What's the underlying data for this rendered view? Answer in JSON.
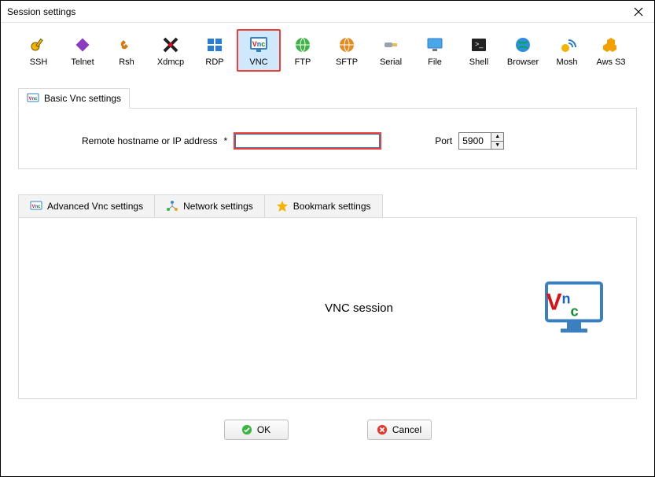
{
  "window": {
    "title": "Session settings"
  },
  "toolbar": {
    "items": [
      {
        "label": "SSH"
      },
      {
        "label": "Telnet"
      },
      {
        "label": "Rsh"
      },
      {
        "label": "Xdmcp"
      },
      {
        "label": "RDP"
      },
      {
        "label": "VNC"
      },
      {
        "label": "FTP"
      },
      {
        "label": "SFTP"
      },
      {
        "label": "Serial"
      },
      {
        "label": "File"
      },
      {
        "label": "Shell"
      },
      {
        "label": "Browser"
      },
      {
        "label": "Mosh"
      },
      {
        "label": "Aws S3"
      }
    ],
    "selected_index": 5
  },
  "basic": {
    "tab_label": "Basic Vnc settings",
    "hostname_label": "Remote hostname or IP address",
    "required_mark": "*",
    "hostname_value": "",
    "port_label": "Port",
    "port_value": "5900"
  },
  "secondary_tabs": {
    "items": [
      {
        "label": "Advanced Vnc settings"
      },
      {
        "label": "Network settings"
      },
      {
        "label": "Bookmark settings"
      }
    ]
  },
  "page": {
    "center_text": "VNC session"
  },
  "buttons": {
    "ok": "OK",
    "cancel": "Cancel"
  }
}
